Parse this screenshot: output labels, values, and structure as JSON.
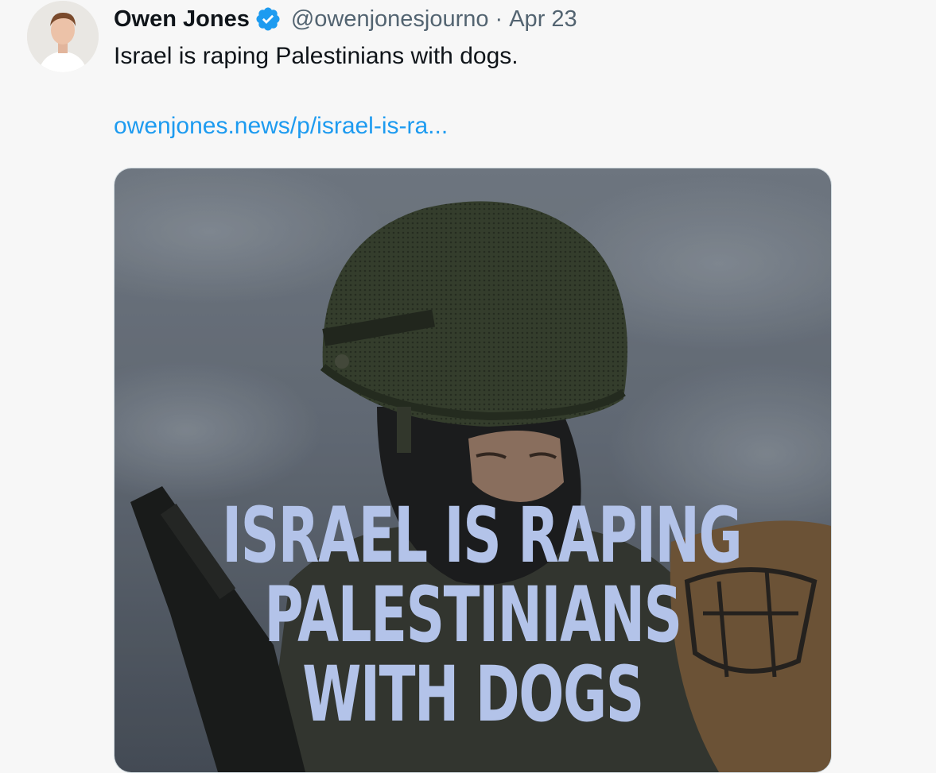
{
  "author": {
    "display_name": "Owen Jones",
    "handle": "@owenjonesjourno",
    "separator": "·",
    "date": "Apr 23",
    "verified": true,
    "avatar_icon": "profile-photo"
  },
  "tweet": {
    "text": "Israel is raping Palestinians with dogs.",
    "link": "owenjones.news/p/israel-is-ra..."
  },
  "media": {
    "headline": {
      "line1": "ISRAEL IS RAPING",
      "line2": "PALESTINIANS",
      "line3": "WITH DOGS"
    }
  },
  "colors": {
    "background": "#f7f7f7",
    "text": "#0f1419",
    "secondary_text": "#536471",
    "link": "#1d9bf0",
    "verified_badge": "#1d9bf0",
    "headline_text": "#b3c3e9"
  }
}
